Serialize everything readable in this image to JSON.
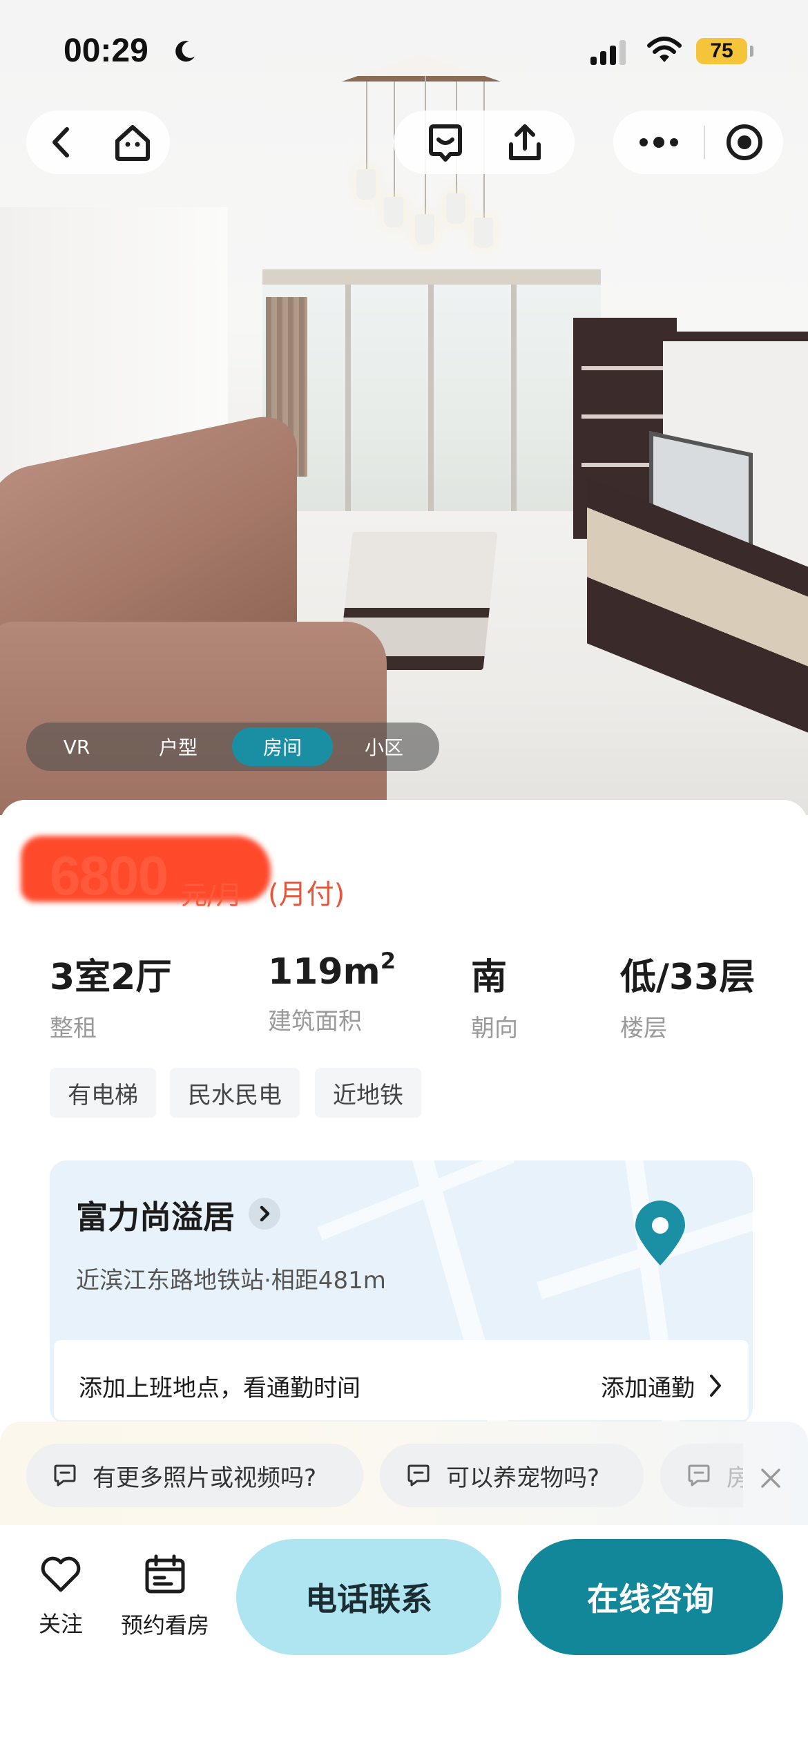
{
  "status_bar": {
    "time": "00:29",
    "battery": "75"
  },
  "media_tabs": [
    {
      "label": "VR"
    },
    {
      "label": "户型"
    },
    {
      "label": "房间",
      "active": true
    },
    {
      "label": "小区"
    }
  ],
  "listing": {
    "price": "6800",
    "price_unit": "元/月",
    "payment": "(月付)",
    "specs": [
      {
        "value": "3室2厅",
        "label": "整租"
      },
      {
        "value": "119m",
        "value_sup": "2",
        "label": "建筑面积"
      },
      {
        "value": "南",
        "label": "朝向"
      },
      {
        "value": "低/33层",
        "label": "楼层"
      }
    ],
    "tags": [
      "有电梯",
      "民水民电",
      "近地铁"
    ]
  },
  "community": {
    "name": "富力尚溢居",
    "distance": "近滨江东路地铁站·相距481m",
    "commute_hint": "添加上班地点，看通勤时间",
    "commute_link": "添加通勤"
  },
  "quick_questions": [
    "有更多照片或视频吗?",
    "可以养宠物吗?",
    "房"
  ],
  "bottom_bar": {
    "follow": "关注",
    "schedule": "预约看房",
    "call": "电话联系",
    "chat": "在线咨询"
  },
  "colors": {
    "accent": "#13879a",
    "accent_light": "#aee5f0",
    "price": "#ff5a3c",
    "active_tab": "#1a8fa3"
  },
  "icons": {
    "back": "back-chevron-icon",
    "home": "home-icon",
    "message": "message-icon",
    "share": "share-icon",
    "more": "more-dots-icon",
    "close_miniprogram": "record-circle-icon",
    "location": "location-pin-icon",
    "favorite": "heart-icon",
    "calendar": "calendar-icon",
    "question": "chat-bubble-icon",
    "close": "close-icon"
  }
}
